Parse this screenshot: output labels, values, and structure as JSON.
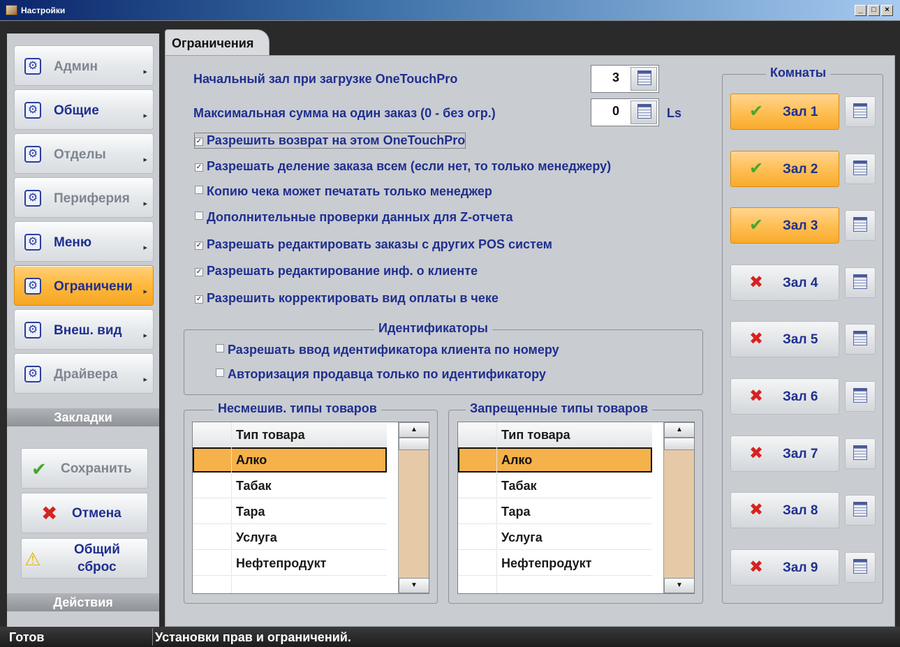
{
  "window": {
    "title": "Настройки",
    "controls": {
      "minimize": "_",
      "maximize": "□",
      "close": "×"
    }
  },
  "sidebar": {
    "items": [
      {
        "label": "Админ",
        "icon": "gear-icon",
        "enabled": false,
        "active": false
      },
      {
        "label": "Общие",
        "icon": "gear-icon",
        "enabled": true,
        "active": false
      },
      {
        "label": "Отделы",
        "icon": "gear-icon",
        "enabled": false,
        "active": false
      },
      {
        "label": "Периферия",
        "icon": "gear-icon",
        "enabled": false,
        "active": false
      },
      {
        "label": "Меню",
        "icon": "gear-icon",
        "enabled": true,
        "active": false
      },
      {
        "label": "Ограничени",
        "icon": "gear-icon",
        "enabled": true,
        "active": true
      },
      {
        "label": "Внеш. вид",
        "icon": "gear-icon",
        "enabled": true,
        "active": false
      },
      {
        "label": "Драйвера",
        "icon": "gear-icon",
        "enabled": false,
        "active": false
      }
    ],
    "bookmarks_label": "Закладки",
    "actions_label": "Действия",
    "actions": {
      "save": {
        "label": "Сохранить",
        "icon": "check-icon",
        "enabled": false
      },
      "cancel": {
        "label": "Отмена",
        "icon": "cross-icon",
        "enabled": true
      },
      "reset": {
        "label_line1": "Общий",
        "label_line2": "сброс",
        "icon": "warning-icon",
        "enabled": true
      }
    }
  },
  "tab": {
    "label": "Ограничения"
  },
  "form": {
    "start_hall": {
      "label": "Начальный зал при загрузке OneTouchPro",
      "value": "3"
    },
    "max_sum": {
      "label": "Максимальная сумма на один заказ (0 - без огр.)",
      "value": "0",
      "unit": "Ls"
    },
    "checkboxes": [
      {
        "label": "Разрешить возврат на этом OneTouchPro",
        "checked": true
      },
      {
        "label": "Разрешать деление заказа всем (если нет, то только менеджеру)",
        "checked": true
      },
      {
        "label": "Копию чека может печатать только менеджер",
        "checked": false
      },
      {
        "label": "Дополнительные проверки данных для Z-отчета",
        "checked": false
      },
      {
        "label": "Разрешать редактировать заказы с других POS систем",
        "checked": true
      },
      {
        "label": "Разрешать редактирование инф. о клиенте",
        "checked": true
      },
      {
        "label": "Разрешить корректировать вид оплаты в чеке",
        "checked": true
      }
    ],
    "identifiers": {
      "title": "Идентификаторы",
      "checkboxes": [
        {
          "label": "Разрешать ввод идентификатора клиента по номеру",
          "checked": false
        },
        {
          "label": "Авторизация продавца только по идентификатору",
          "checked": false
        }
      ]
    },
    "unmixed_types": {
      "title": "Несмешив. типы товаров",
      "column": "Тип товара",
      "rows": [
        "Алко",
        "Табак",
        "Тара",
        "Услуга",
        "Нефтепродукт"
      ],
      "selected": 0
    },
    "forbidden_types": {
      "title": "Запрещенные типы товаров",
      "column": "Тип товара",
      "rows": [
        "Алко",
        "Табак",
        "Тара",
        "Услуга",
        "Нефтепродукт"
      ],
      "selected": 0
    }
  },
  "rooms": {
    "title": "Комнаты",
    "items": [
      {
        "label": "Зал 1",
        "enabled": true
      },
      {
        "label": "Зал 2",
        "enabled": true
      },
      {
        "label": "Зал 3",
        "enabled": true
      },
      {
        "label": "Зал 4",
        "enabled": false
      },
      {
        "label": "Зал 5",
        "enabled": false
      },
      {
        "label": "Зал 6",
        "enabled": false
      },
      {
        "label": "Зал 7",
        "enabled": false
      },
      {
        "label": "Зал 8",
        "enabled": false
      },
      {
        "label": "Зал 9",
        "enabled": false
      }
    ]
  },
  "status": {
    "state": "Готов",
    "message": "Установки прав и ограничений."
  },
  "colors": {
    "accent_orange": "#f8ab2d",
    "label_blue": "#1f2f8f",
    "ok_green": "#47a72b",
    "cancel_red": "#d8221f"
  }
}
